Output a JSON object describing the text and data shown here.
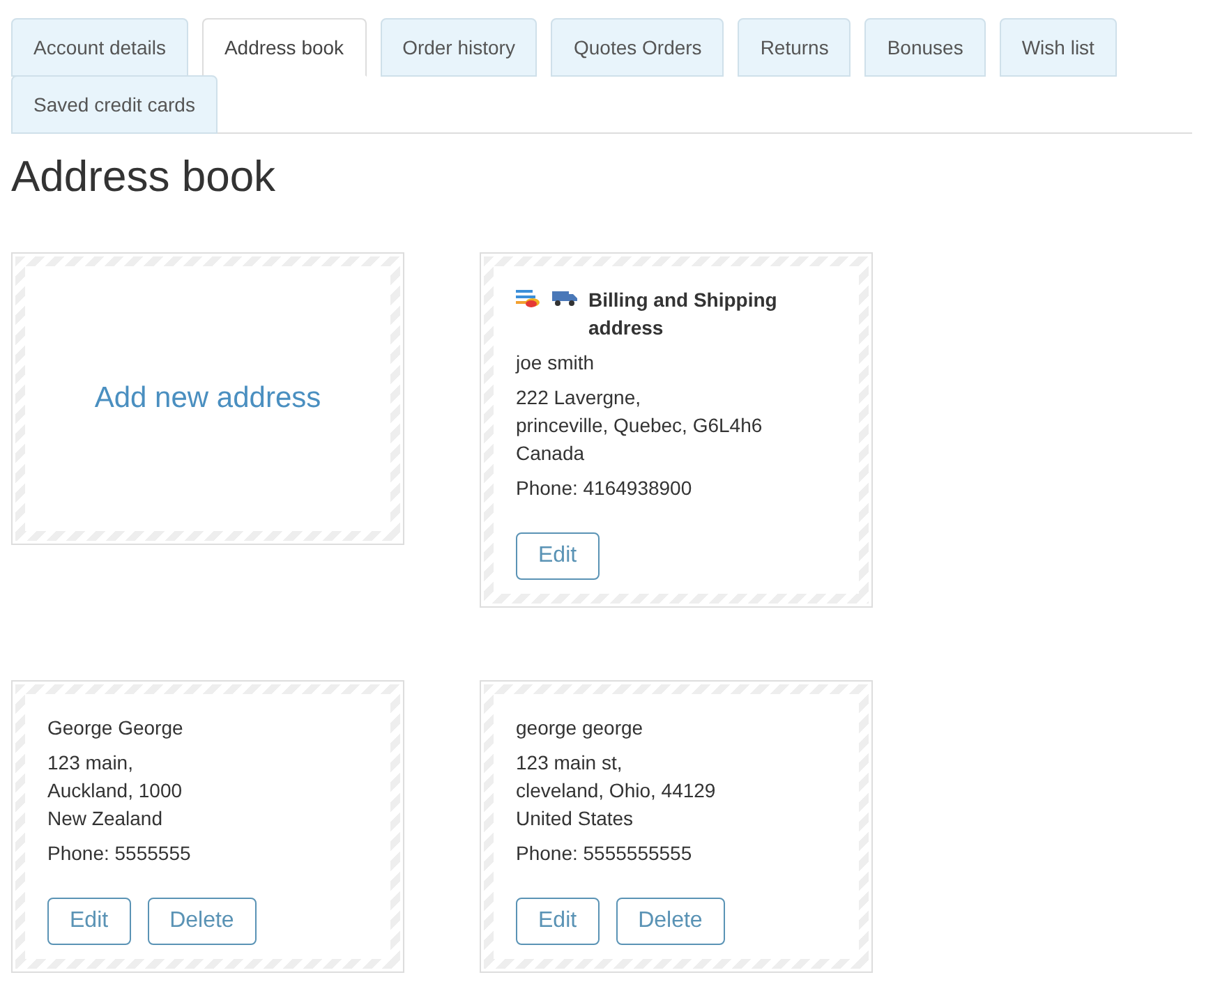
{
  "tabs": [
    {
      "label": "Account details",
      "selected": false
    },
    {
      "label": "Address book",
      "selected": true
    },
    {
      "label": "Order history",
      "selected": false
    },
    {
      "label": "Quotes Orders",
      "selected": false
    },
    {
      "label": "Returns",
      "selected": false
    },
    {
      "label": "Bonuses",
      "selected": false
    },
    {
      "label": "Wish list",
      "selected": false
    },
    {
      "label": "Saved credit cards",
      "selected": false
    }
  ],
  "heading": "Address book",
  "cards": [
    {
      "kind": "add",
      "label": "Add new address"
    },
    {
      "kind": "address",
      "default_billing": true,
      "default_shipping": true,
      "badge": "Billing and Shipping address",
      "name": "joe smith",
      "lines": [
        "222 Lavergne,",
        "princeville, Quebec, G6L4h6",
        "Canada"
      ],
      "phone": "Phone: 4164938900",
      "buttons": [
        "Edit"
      ]
    },
    {
      "kind": "address",
      "default_billing": false,
      "default_shipping": false,
      "name": "George George",
      "lines": [
        "123 main,",
        "Auckland, 1000",
        "New Zealand"
      ],
      "phone": "Phone: 5555555",
      "buttons": [
        "Edit",
        "Delete"
      ]
    },
    {
      "kind": "address",
      "default_billing": false,
      "default_shipping": false,
      "name": "george george",
      "lines": [
        "123 main st,",
        "cleveland, Ohio, 44129",
        "United States"
      ],
      "phone": "Phone: 5555555555",
      "buttons": [
        "Edit",
        "Delete"
      ]
    }
  ]
}
